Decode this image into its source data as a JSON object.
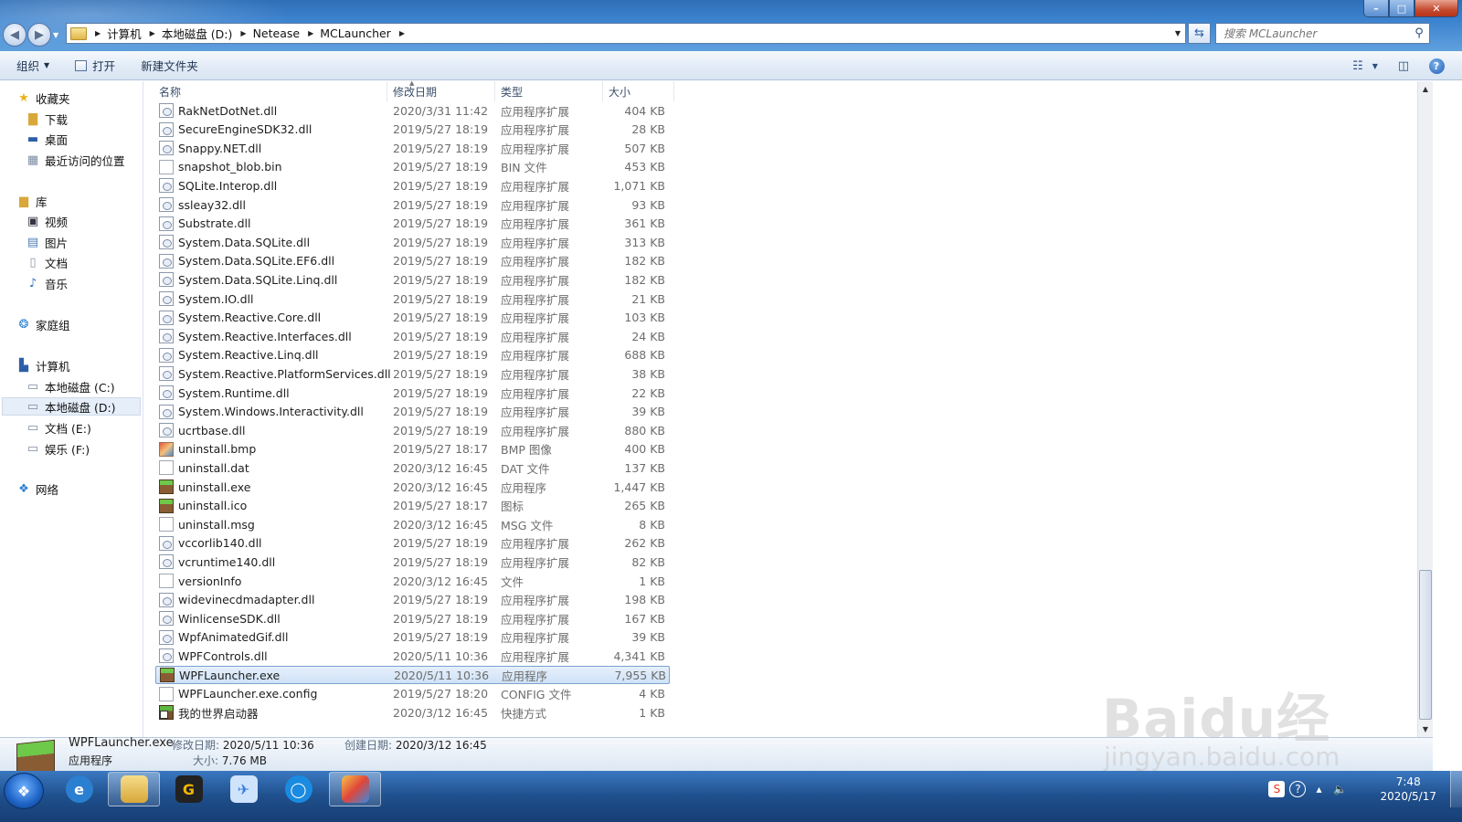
{
  "window": {
    "search_placeholder": "搜索 MCLauncher",
    "breadcrumb": [
      "计算机",
      "本地磁盘 (D:)",
      "Netease",
      "MCLauncher"
    ]
  },
  "toolbar": {
    "organize": "组织",
    "open": "打开",
    "new_folder": "新建文件夹"
  },
  "nav": {
    "favorites": "收藏夹",
    "downloads": "下载",
    "desktop": "桌面",
    "recent": "最近访问的位置",
    "libraries": "库",
    "videos": "视频",
    "pictures": "图片",
    "documents": "文档",
    "music": "音乐",
    "homegroup": "家庭组",
    "computer": "计算机",
    "drive_c": "本地磁盘 (C:)",
    "drive_d": "本地磁盘 (D:)",
    "drive_e": "文档 (E:)",
    "drive_f": "娱乐 (F:)",
    "network": "网络"
  },
  "columns": {
    "name": "名称",
    "date": "修改日期",
    "type": "类型",
    "size": "大小"
  },
  "files": [
    {
      "name": "RakNetDotNet.dll",
      "date": "2020/3/31 11:42",
      "type": "应用程序扩展",
      "size": "404 KB",
      "icon": "dll"
    },
    {
      "name": "SecureEngineSDK32.dll",
      "date": "2019/5/27 18:19",
      "type": "应用程序扩展",
      "size": "28 KB",
      "icon": "dll"
    },
    {
      "name": "Snappy.NET.dll",
      "date": "2019/5/27 18:19",
      "type": "应用程序扩展",
      "size": "507 KB",
      "icon": "dll"
    },
    {
      "name": "snapshot_blob.bin",
      "date": "2019/5/27 18:19",
      "type": "BIN 文件",
      "size": "453 KB",
      "icon": "file"
    },
    {
      "name": "SQLite.Interop.dll",
      "date": "2019/5/27 18:19",
      "type": "应用程序扩展",
      "size": "1,071 KB",
      "icon": "dll"
    },
    {
      "name": "ssleay32.dll",
      "date": "2019/5/27 18:19",
      "type": "应用程序扩展",
      "size": "93 KB",
      "icon": "dll"
    },
    {
      "name": "Substrate.dll",
      "date": "2019/5/27 18:19",
      "type": "应用程序扩展",
      "size": "361 KB",
      "icon": "dll"
    },
    {
      "name": "System.Data.SQLite.dll",
      "date": "2019/5/27 18:19",
      "type": "应用程序扩展",
      "size": "313 KB",
      "icon": "dll"
    },
    {
      "name": "System.Data.SQLite.EF6.dll",
      "date": "2019/5/27 18:19",
      "type": "应用程序扩展",
      "size": "182 KB",
      "icon": "dll"
    },
    {
      "name": "System.Data.SQLite.Linq.dll",
      "date": "2019/5/27 18:19",
      "type": "应用程序扩展",
      "size": "182 KB",
      "icon": "dll"
    },
    {
      "name": "System.IO.dll",
      "date": "2019/5/27 18:19",
      "type": "应用程序扩展",
      "size": "21 KB",
      "icon": "dll"
    },
    {
      "name": "System.Reactive.Core.dll",
      "date": "2019/5/27 18:19",
      "type": "应用程序扩展",
      "size": "103 KB",
      "icon": "dll"
    },
    {
      "name": "System.Reactive.Interfaces.dll",
      "date": "2019/5/27 18:19",
      "type": "应用程序扩展",
      "size": "24 KB",
      "icon": "dll"
    },
    {
      "name": "System.Reactive.Linq.dll",
      "date": "2019/5/27 18:19",
      "type": "应用程序扩展",
      "size": "688 KB",
      "icon": "dll"
    },
    {
      "name": "System.Reactive.PlatformServices.dll",
      "date": "2019/5/27 18:19",
      "type": "应用程序扩展",
      "size": "38 KB",
      "icon": "dll"
    },
    {
      "name": "System.Runtime.dll",
      "date": "2019/5/27 18:19",
      "type": "应用程序扩展",
      "size": "22 KB",
      "icon": "dll"
    },
    {
      "name": "System.Windows.Interactivity.dll",
      "date": "2019/5/27 18:19",
      "type": "应用程序扩展",
      "size": "39 KB",
      "icon": "dll"
    },
    {
      "name": "ucrtbase.dll",
      "date": "2019/5/27 18:19",
      "type": "应用程序扩展",
      "size": "880 KB",
      "icon": "dll"
    },
    {
      "name": "uninstall.bmp",
      "date": "2019/5/27 18:17",
      "type": "BMP 图像",
      "size": "400 KB",
      "icon": "bmp"
    },
    {
      "name": "uninstall.dat",
      "date": "2020/3/12 16:45",
      "type": "DAT 文件",
      "size": "137 KB",
      "icon": "file"
    },
    {
      "name": "uninstall.exe",
      "date": "2020/3/12 16:45",
      "type": "应用程序",
      "size": "1,447 KB",
      "icon": "exe"
    },
    {
      "name": "uninstall.ico",
      "date": "2019/5/27 18:17",
      "type": "图标",
      "size": "265 KB",
      "icon": "exe"
    },
    {
      "name": "uninstall.msg",
      "date": "2020/3/12 16:45",
      "type": "MSG 文件",
      "size": "8 KB",
      "icon": "file"
    },
    {
      "name": "vccorlib140.dll",
      "date": "2019/5/27 18:19",
      "type": "应用程序扩展",
      "size": "262 KB",
      "icon": "dll"
    },
    {
      "name": "vcruntime140.dll",
      "date": "2019/5/27 18:19",
      "type": "应用程序扩展",
      "size": "82 KB",
      "icon": "dll"
    },
    {
      "name": "versionInfo",
      "date": "2020/3/12 16:45",
      "type": "文件",
      "size": "1 KB",
      "icon": "file"
    },
    {
      "name": "widevinecdmadapter.dll",
      "date": "2019/5/27 18:19",
      "type": "应用程序扩展",
      "size": "198 KB",
      "icon": "dll"
    },
    {
      "name": "WinlicenseSDK.dll",
      "date": "2019/5/27 18:19",
      "type": "应用程序扩展",
      "size": "167 KB",
      "icon": "dll"
    },
    {
      "name": "WpfAnimatedGif.dll",
      "date": "2019/5/27 18:19",
      "type": "应用程序扩展",
      "size": "39 KB",
      "icon": "dll"
    },
    {
      "name": "WPFControls.dll",
      "date": "2020/5/11 10:36",
      "type": "应用程序扩展",
      "size": "4,341 KB",
      "icon": "dll"
    },
    {
      "name": "WPFLauncher.exe",
      "date": "2020/5/11 10:36",
      "type": "应用程序",
      "size": "7,955 KB",
      "icon": "exe",
      "selected": true
    },
    {
      "name": "WPFLauncher.exe.config",
      "date": "2019/5/27 18:20",
      "type": "CONFIG 文件",
      "size": "4 KB",
      "icon": "file"
    },
    {
      "name": "我的世界启动器",
      "date": "2020/3/12 16:45",
      "type": "快捷方式",
      "size": "1 KB",
      "icon": "lnk"
    }
  ],
  "details": {
    "filename": "WPFLauncher.exe",
    "type": "应用程序",
    "modified_label": "修改日期:",
    "modified": "2020/5/11 10:36",
    "created_label": "创建日期:",
    "created": "2020/3/12 16:45",
    "size_label": "大小:",
    "size": "7.76 MB"
  },
  "taskbar": {
    "time": "7:48",
    "date": "2020/5/17"
  },
  "watermark": {
    "main": "Baidu经验",
    "sub": "jingyan.baidu.com"
  },
  "colors": {
    "selection": "#cfe2f7",
    "titlebar": "#3c83cf",
    "taskbar": "#1f4f8c"
  }
}
